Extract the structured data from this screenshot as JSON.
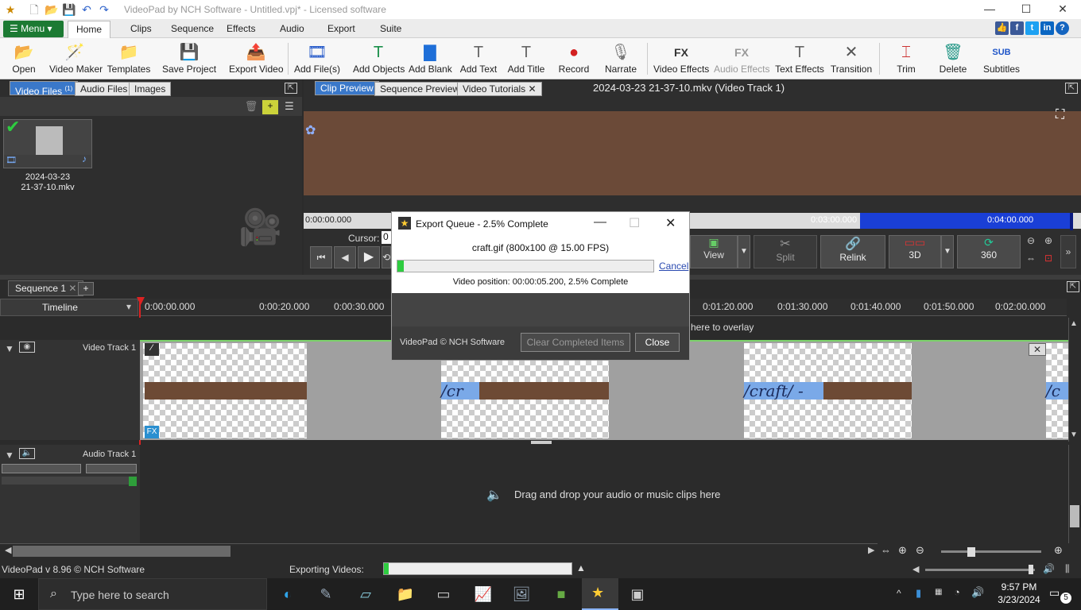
{
  "window": {
    "title": "VideoPad by NCH Software - Untitled.vpj* - Licensed software",
    "minimize": "—",
    "maximize": "☐",
    "close": "✕"
  },
  "menu": {
    "menu_label": "Menu",
    "tabs": [
      "Home",
      "Clips",
      "Sequence",
      "Effects",
      "Audio",
      "Export",
      "Suite"
    ]
  },
  "toolbar": {
    "items": [
      {
        "label": "Open",
        "icon": "📂"
      },
      {
        "label": "Video Maker",
        "icon": "🪄"
      },
      {
        "label": "Templates",
        "icon": "📁"
      },
      {
        "label": "Save Project",
        "icon": "💾"
      },
      {
        "label": "Export Video",
        "icon": "📤"
      },
      {
        "label": "Add File(s)",
        "icon": "🎞"
      },
      {
        "label": "Add Objects",
        "icon": "T"
      },
      {
        "label": "Add Blank",
        "icon": "▇"
      },
      {
        "label": "Add Text",
        "icon": "T"
      },
      {
        "label": "Add Title",
        "icon": "T"
      },
      {
        "label": "Record",
        "icon": "●"
      },
      {
        "label": "Narrate",
        "icon": "🎙"
      },
      {
        "label": "Video Effects",
        "icon": "FX"
      },
      {
        "label": "Audio Effects",
        "icon": "FX"
      },
      {
        "label": "Text Effects",
        "icon": "T"
      },
      {
        "label": "Transition",
        "icon": "✕"
      },
      {
        "label": "Trim",
        "icon": "⌶"
      },
      {
        "label": "Delete",
        "icon": "🗑"
      },
      {
        "label": "Subtitles",
        "icon": "SUB"
      }
    ]
  },
  "media_bin": {
    "tabs": [
      "Video Files",
      "Audio Files",
      "Images"
    ],
    "video_files_badge": "(1)",
    "clip_name_line1": "2024-03-23",
    "clip_name_line2": "21-37-10.mkv"
  },
  "preview": {
    "tabs": [
      "Clip Preview",
      "Sequence Preview",
      "Video Tutorials"
    ],
    "clip_title": "2024-03-23 21-37-10.mkv (Video Track 1)",
    "time_start": "0:00:00.000",
    "time_3": "0:03:00.000",
    "time_4": "0:04:00.000",
    "cursor_label": "Cursor:",
    "cursor_value": "0",
    "buttons": {
      "view": "View",
      "split": "Split",
      "relink": "Relink",
      "three_d": "3D",
      "three_sixty": "360"
    }
  },
  "sequence": {
    "tab": "Sequence 1",
    "add_tab": "+",
    "timeline_label": "Timeline",
    "ruler": [
      "0:00:00.000",
      "0:00:20.000",
      "0:00:30.000",
      "0:01:20.000",
      "0:01:30.000",
      "0:01:40.000",
      "0:01:50.000",
      "0:02:00.000"
    ],
    "overlay_hint": "here to overlay",
    "video_track": "Video Track 1",
    "audio_track": "Audio Track 1",
    "audio_drop_hint": "Drag and drop your audio or music clips here",
    "clip_text": [
      "/cr",
      "/craft/ -",
      "/c"
    ],
    "fx_badge": "FX"
  },
  "dialog": {
    "title": "Export Queue - 2.5% Complete",
    "file": "craft.gif (800x100 @ 15.00 FPS)",
    "progress": 0.025,
    "cancel": "Cancel",
    "status": "Video position:  00:00:05.200, 2.5% Complete",
    "footer": "VideoPad © NCH Software",
    "clear_btn": "Clear Completed Items",
    "close_btn": "Close"
  },
  "statusbar": {
    "version": "VideoPad v 8.96 © NCH Software",
    "exporting_label": "Exporting Videos:"
  },
  "taskbar": {
    "search_placeholder": "Type here to search",
    "time": "9:57 PM",
    "date": "3/23/2024",
    "notif_count": "5"
  },
  "colors": {
    "accent_blue": "#3a78c9",
    "menu_green": "#1c7a33",
    "clip_brown": "#6d4a35",
    "range_blue": "#1a3fd6"
  }
}
